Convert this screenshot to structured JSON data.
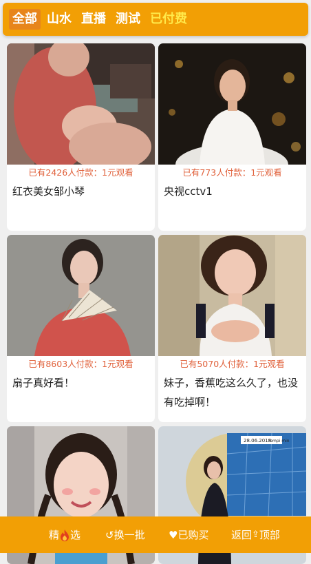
{
  "tabs": [
    {
      "label": "全部",
      "active": true
    },
    {
      "label": "山水"
    },
    {
      "label": "直播"
    },
    {
      "label": "测试"
    },
    {
      "label": "已付费",
      "paid": true
    }
  ],
  "cards": [
    {
      "meta": "已有2426人付款：1元观看",
      "title": "红衣美女邹小琴"
    },
    {
      "meta": "已有773人付款：1元观看",
      "title": "央视cctv1"
    },
    {
      "meta": "已有8603人付款：1元观看",
      "title": "扇子真好看！"
    },
    {
      "meta": "已有5070人付款：1元观看",
      "title": "妹子，香蕉吃这么久了，也没有吃掉啊！"
    },
    {
      "meta": "",
      "title": ""
    },
    {
      "meta": "",
      "title": ""
    }
  ],
  "weather_card": {
    "date": "28.06.2018",
    "label": "tempi min"
  },
  "bottom": {
    "pick_pre": "精",
    "pick_post": "选",
    "refresh": "↺换一批",
    "bought": "♥已购买",
    "top_pre": "返回",
    "top_icon": "⇪",
    "top_post": "顶部"
  },
  "colors": {
    "accent": "#f29f05",
    "meta_text": "#e0603a",
    "paid_tab": "#ffe94a"
  }
}
